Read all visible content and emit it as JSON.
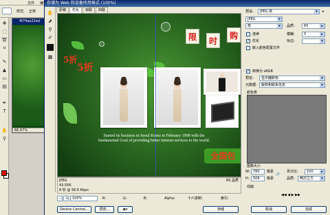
{
  "ps": {
    "menu": [
      "文件",
      "编辑"
    ],
    "options": {
      "style_label": "样式:",
      "style_value": "正常"
    },
    "doc_title": "4f74ae22ed",
    "zoom": "66.67%",
    "fg_color": "#e00000",
    "bg_color": "#ffffff"
  },
  "dialog": {
    "title": "存储为 Web 和设备所用格式 (100%)",
    "tabs": [
      "原稿",
      "优化",
      "双联",
      "四联"
    ],
    "active_tab": 1
  },
  "canvas": {
    "deco_left": "5折",
    "deco_left2": "5折",
    "signs": [
      "限",
      "时",
      "购"
    ],
    "caption_line1": "Started its business in Seoul Korea in February 1998 with the",
    "caption_line2": "fundamental Goal of providing better internet services to the world.",
    "green_sign": "全国包"
  },
  "info": {
    "format": "JPEG",
    "size": "43.55K",
    "time": "8 秒 @ 56.6 Kbps",
    "quality": "60 品质"
  },
  "status": {
    "zoom": "100%",
    "r_label": "R:",
    "g_label": "G:",
    "b_label": "B:",
    "alpha_label": "Alpha:",
    "hex_label": "十六进制:",
    "index_label": "索引:"
  },
  "buttons": {
    "device_central": "Device Central...",
    "preview": "预览...",
    "save": "存储",
    "cancel": "取消",
    "done": "完成"
  },
  "panel": {
    "preset_label": "预设:",
    "preset_value": "JPEG 高",
    "format_value": "JPEG",
    "compression_value": "高",
    "quality_label": "品质:",
    "quality_value": "60",
    "progressive_label": "连续",
    "optimized_label": "优化",
    "embed_label": "嵌入颜色配置文件",
    "blur_label": "模糊:",
    "blur_value": "0",
    "matte_label": "杂边:",
    "srgb_label": "转换为 sRGB",
    "preview_label": "预览:",
    "preview_value": "显示器颜色",
    "metadata_label": "元数据:",
    "metadata_value": "版权和联系信息",
    "color_table_label": "颜色表",
    "image_size_label": "图像大小",
    "w_label": "W:",
    "w_value": "780",
    "h_label": "H:",
    "h_value": "508",
    "px_label": "像素",
    "percent_label": "百分比:",
    "percent_value": "100",
    "quality2_label": "品质:",
    "quality2_value": "两次立方",
    "animation_label": "动画"
  }
}
